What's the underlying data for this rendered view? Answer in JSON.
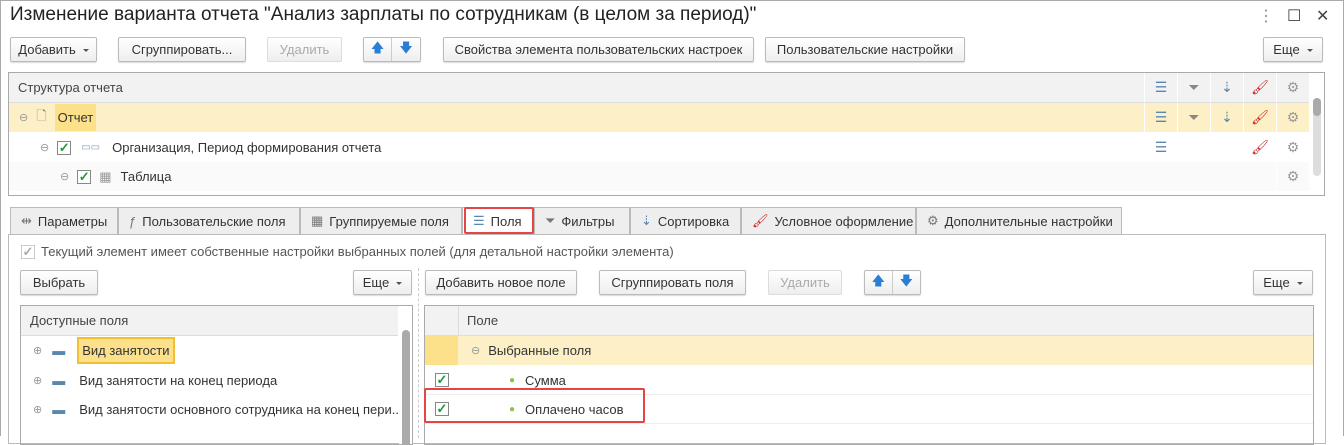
{
  "title": "Изменение варианта отчета \"Анализ зарплаты по сотрудникам (в целом за период)\"",
  "window": {
    "menu": "⋮",
    "maximize": "☐",
    "close": "✕"
  },
  "toolbar": {
    "add": "Добавить",
    "group": "Сгруппировать...",
    "delete": "Удалить",
    "up": "🡅",
    "down": "🡇",
    "props": "Свойства элемента пользовательских настроек",
    "user_settings": "Пользовательские настройки",
    "more": "Еще"
  },
  "structure": {
    "header": "Структура отчета",
    "rows": [
      {
        "label": "Отчет"
      },
      {
        "label": "Организация, Период формирования отчета"
      },
      {
        "label": "Таблица"
      }
    ]
  },
  "tabs": [
    {
      "label": "Параметры"
    },
    {
      "label": "Пользовательские поля"
    },
    {
      "label": "Группируемые поля"
    },
    {
      "label": "Поля"
    },
    {
      "label": "Фильтры"
    },
    {
      "label": "Сортировка"
    },
    {
      "label": "Условное оформление"
    },
    {
      "label": "Дополнительные настройки"
    }
  ],
  "fields": {
    "own_settings": "Текущий элемент имеет собственные настройки выбранных полей (для детальной настройки элемента)",
    "left": {
      "select": "Выбрать",
      "more": "Еще",
      "header": "Доступные поля",
      "items": [
        "Вид занятости",
        "Вид занятости на конец периода",
        "Вид занятости основного сотрудника на конец пери..."
      ]
    },
    "right": {
      "add": "Добавить новое поле",
      "group": "Сгруппировать поля",
      "delete": "Удалить",
      "more": "Еще",
      "header": "Поле",
      "group_row": "Выбранные поля",
      "items": [
        "Сумма",
        "Оплачено часов"
      ]
    }
  }
}
